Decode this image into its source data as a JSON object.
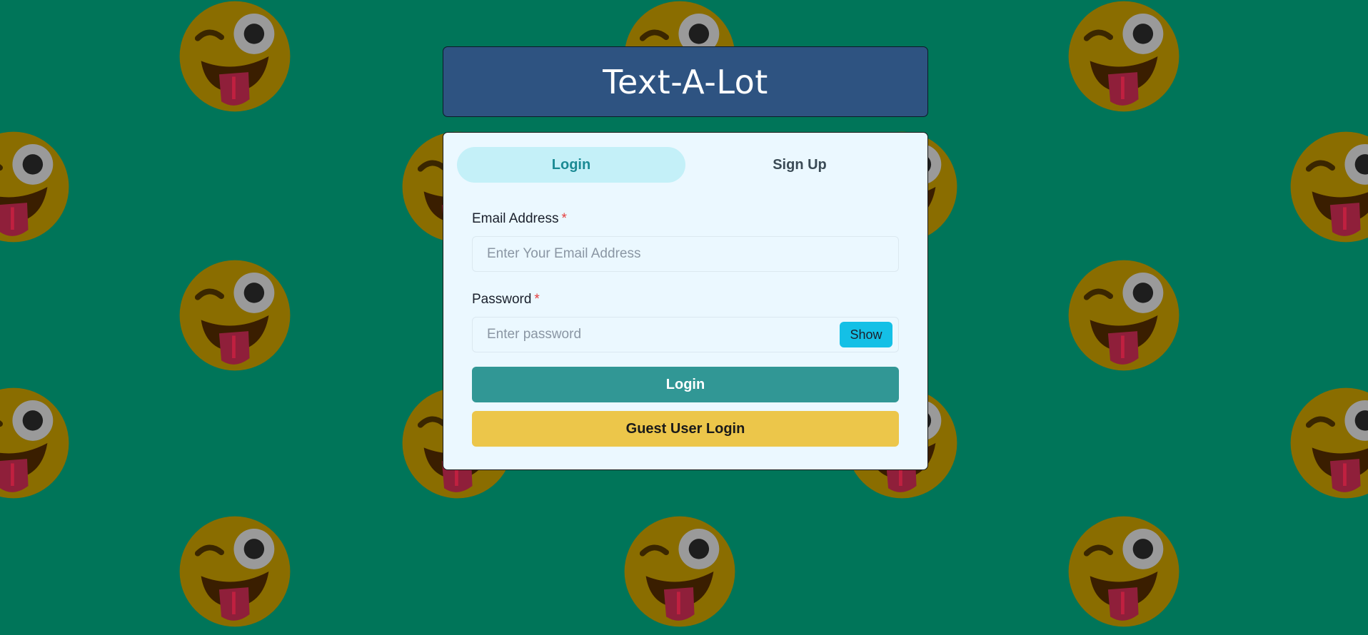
{
  "app": {
    "title": "Text-A-Lot"
  },
  "background": {
    "color": "#007559",
    "pattern_icon": "winking-tongue-emoji-icon"
  },
  "tabs": [
    {
      "label": "Login",
      "active": true
    },
    {
      "label": "Sign Up",
      "active": false
    }
  ],
  "form": {
    "email": {
      "label": "Email Address",
      "required_mark": "*",
      "placeholder": "Enter Your Email Address",
      "value": ""
    },
    "password": {
      "label": "Password",
      "required_mark": "*",
      "placeholder": "Enter password",
      "value": "",
      "toggle_label": "Show"
    },
    "login_button": "Login",
    "guest_button": "Guest User Login"
  },
  "colors": {
    "header_bg": "#2e5381",
    "card_bg": "#ebf8ff",
    "tab_active_bg": "#c4f0f8",
    "tab_active_text": "#1a8a94",
    "login_button": "#319795",
    "guest_button": "#ecc64a",
    "show_button": "#14c0e6",
    "required": "#e53e3e"
  }
}
